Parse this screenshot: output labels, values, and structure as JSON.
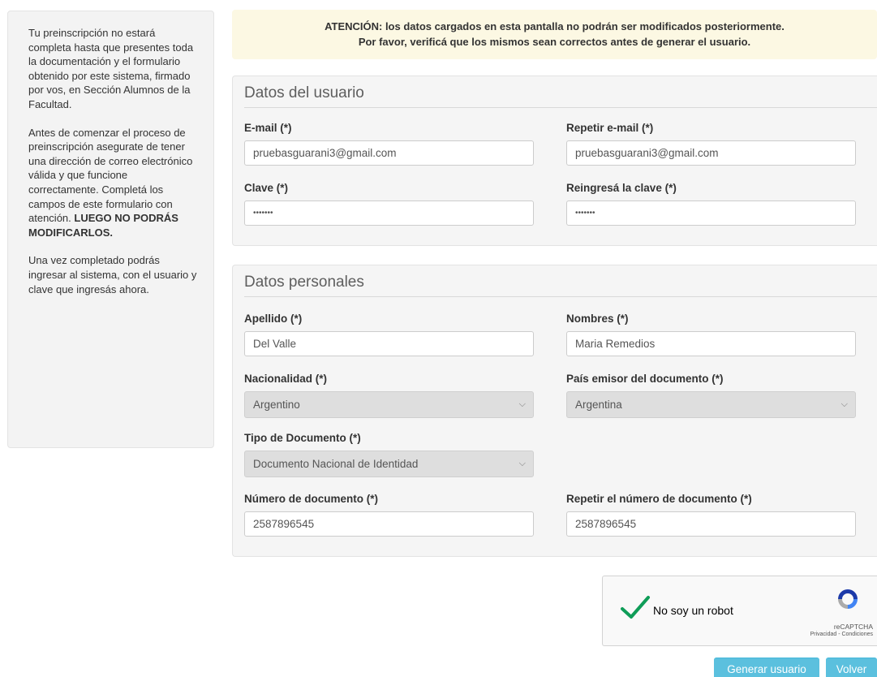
{
  "sidebar": {
    "para1": "Tu preinscripción no estará completa hasta que presentes toda la documentación y el formulario obtenido por este sistema, firmado por vos, en Sección Alumnos de la Facultad.",
    "para2_pre": "Antes de comenzar el proceso de preinscripción asegurate de tener una dirección de correo electrónico válida y que funcione correctamente. Completá los campos de este formulario con atención.",
    "para2_bold": "LUEGO NO PODRÁS MODIFICARLOS.",
    "para3": "Una vez completado podrás ingresar al sistema, con el usuario y clave que ingresás ahora."
  },
  "banner": {
    "line1": "ATENCIÓN: los datos cargados en esta pantalla no podrán ser modificados posteriormente.",
    "line2": "Por favor, verificá que los mismos sean correctos antes de generar el usuario."
  },
  "user_section": {
    "title": "Datos del usuario",
    "email_label": "E-mail (*)",
    "email_value": "pruebasguarani3@gmail.com",
    "email_repeat_label": "Repetir e-mail (*)",
    "email_repeat_value": "pruebasguarani3@gmail.com",
    "password_label": "Clave (*)",
    "password_value": "•••••••",
    "password_repeat_label": "Reingresá la clave (*)",
    "password_repeat_value": "•••••••"
  },
  "personal_section": {
    "title": "Datos personales",
    "lastname_label": "Apellido (*)",
    "lastname_value": "Del Valle",
    "firstname_label": "Nombres (*)",
    "firstname_value": "Maria Remedios",
    "nationality_label": "Nacionalidad (*)",
    "nationality_value": "Argentino",
    "issuer_label": "País emisor del documento (*)",
    "issuer_value": "Argentina",
    "doctype_label": "Tipo de Documento (*)",
    "doctype_value": "Documento Nacional de Identidad",
    "docnum_label": "Número de documento (*)",
    "docnum_value": "2587896545",
    "docnum_repeat_label": "Repetir el número de documento (*)",
    "docnum_repeat_value": "2587896545"
  },
  "captcha": {
    "label": "No soy un robot",
    "brand": "reCAPTCHA",
    "links": "Privacidad - Condiciones",
    "checked": true,
    "check_color": "#0f9d58"
  },
  "buttons": {
    "generate": "Generar usuario",
    "back": "Volver",
    "color": "#5bc0de"
  },
  "icons": {
    "select_chevron": "chevron-down-icon",
    "captcha_check": "checkmark-icon",
    "captcha_logo": "recaptcha-logo-icon"
  }
}
